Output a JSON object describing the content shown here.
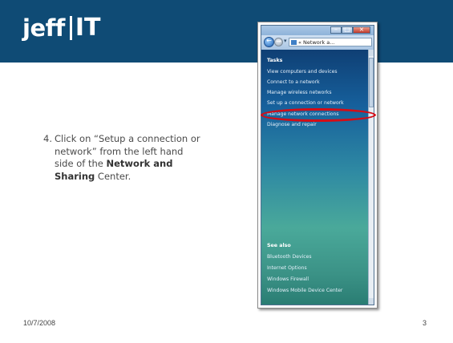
{
  "logo": {
    "name": "jeff",
    "suffix": "IT"
  },
  "instruction": {
    "number": "4.",
    "line1": "Click on “Setup a connection or",
    "line2": "network” from the left hand",
    "line3_prefix": "side of the ",
    "line3_bold": "Network and",
    "line4_bold": "Sharing",
    "line4_suffix": " Center."
  },
  "footer": {
    "date": "10/7/2008",
    "page": "3"
  },
  "window": {
    "address_text": "« Network a...",
    "tasks_heading": "Tasks",
    "tasks": [
      "View computers and devices",
      "Connect to a network",
      "Manage wireless networks",
      "Set up a connection or network",
      "Manage network connections",
      "Diagnose and repair"
    ],
    "see_also_heading": "See also",
    "see_also": [
      "Bluetooth Devices",
      "Internet Options",
      "Windows Firewall",
      "Windows Mobile Device Center"
    ],
    "highlighted_task_index": 3,
    "highlight_color": "#d40d16"
  },
  "colors": {
    "header": "#0f4b75",
    "highlight": "#d40d16"
  }
}
